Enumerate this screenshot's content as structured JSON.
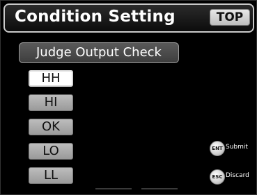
{
  "header": {
    "title": "Condition Setting",
    "top_label": "TOP"
  },
  "subheader": {
    "label": "Judge Output Check"
  },
  "judge_buttons": [
    {
      "label": "HH",
      "selected": true
    },
    {
      "label": "HI",
      "selected": false
    },
    {
      "label": "OK",
      "selected": false
    },
    {
      "label": "LO",
      "selected": false
    },
    {
      "label": "LL",
      "selected": false
    }
  ],
  "keys": {
    "ent": {
      "key": "ENT",
      "label": "Submit"
    },
    "esc": {
      "key": "ESC",
      "label": "Discard"
    }
  },
  "colors": {
    "screen_bg": "#000000",
    "button_gray": "#a8a8a8",
    "selected_button": "#ffffff",
    "text_light": "#ffffff"
  }
}
